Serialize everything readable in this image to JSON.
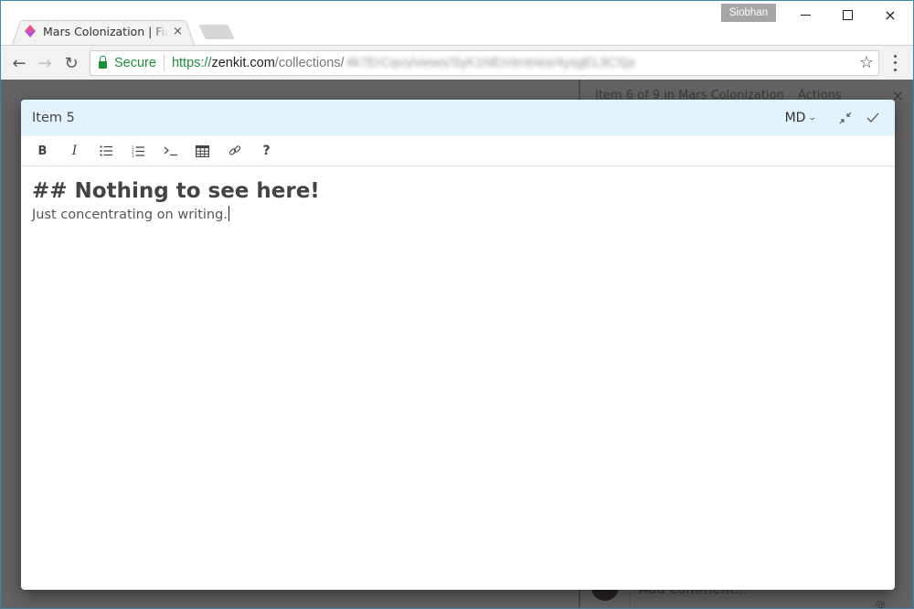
{
  "browser": {
    "tab": {
      "title": "Mars Colonization | Find",
      "favicon": "zenkit-diamond-icon",
      "close": "×"
    },
    "profile_name": "Siobhan",
    "window_controls": {
      "minimize": "minimize-icon",
      "maximize": "maximize-icon",
      "close": "×"
    },
    "nav": {
      "back": "←",
      "forward": "→",
      "reload": "↻"
    },
    "address": {
      "security_label": "Secure",
      "scheme": "https://",
      "host": "zenkit.com",
      "path": "/collections/",
      "blurred": "4k7ErCqvs/views/SyK1NEn/entries/4ysgEL9CSjx"
    },
    "bookmark": "☆"
  },
  "background_app": {
    "detail_header": "Item 6 of 9 in Mars Colonization",
    "actions_label": "Actions",
    "close": "×",
    "comment_placeholder": "Add comment...",
    "mention_icon": "@"
  },
  "editor": {
    "title": "Item 5",
    "format_select": "MD",
    "toolbar": [
      {
        "name": "bold-button",
        "label": "B"
      },
      {
        "name": "italic-button",
        "label": "I"
      },
      {
        "name": "bullet-list-button",
        "label": "bullet-list-icon"
      },
      {
        "name": "numbered-list-button",
        "label": "numbered-list-icon"
      },
      {
        "name": "code-button",
        "label": "›_"
      },
      {
        "name": "table-button",
        "label": "table-icon"
      },
      {
        "name": "link-button",
        "label": "link-icon"
      },
      {
        "name": "help-button",
        "label": "?"
      }
    ],
    "content": {
      "heading": "## Nothing to see here!",
      "line": "Just concentrating on writing."
    }
  },
  "colors": {
    "header_bg": "#e3f3fc",
    "secure_green": "#1e8e3e",
    "overlay": "#636363",
    "window_border": "#3c8ba6"
  }
}
